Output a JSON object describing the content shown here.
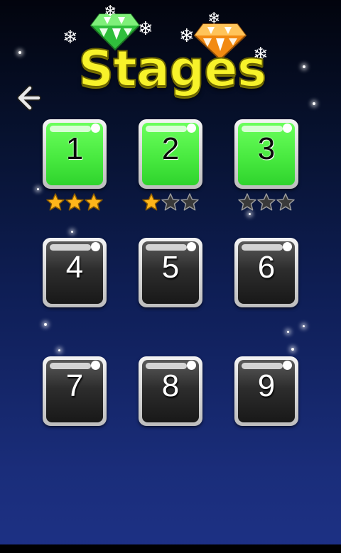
{
  "screen": {
    "title": "Stages",
    "back_icon": "back-arrow-icon"
  },
  "colors": {
    "title": "#f7f22a",
    "unlocked_tile": "#46e83e",
    "locked_tile": "#2d2d2d",
    "star_filled": "#ffb61a",
    "star_empty": "#3a3a3a"
  },
  "stages": [
    {
      "label": "1",
      "unlocked": true,
      "stars": 3
    },
    {
      "label": "2",
      "unlocked": true,
      "stars": 1
    },
    {
      "label": "3",
      "unlocked": true,
      "stars": 0
    },
    {
      "label": "4",
      "unlocked": false
    },
    {
      "label": "5",
      "unlocked": false
    },
    {
      "label": "6",
      "unlocked": false
    },
    {
      "label": "7",
      "unlocked": false
    },
    {
      "label": "8",
      "unlocked": false
    },
    {
      "label": "9",
      "unlocked": false
    }
  ],
  "max_stars": 3
}
